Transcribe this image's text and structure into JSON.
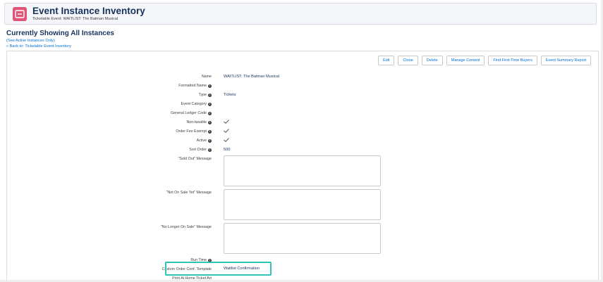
{
  "header": {
    "title": "Event Instance Inventory",
    "subtitle": "Ticketable Event: WAITLIST: The Batman Musical",
    "icon": "ticket-icon",
    "icon_color": "#e05576"
  },
  "page": {
    "showing_title": "Currently Showing All Instances",
    "see_active_link": "(See Active Instances Only)",
    "back_link": "« Back to: Ticketable Event Inventory"
  },
  "toolbar": {
    "buttons": [
      {
        "label": "Edit"
      },
      {
        "label": "Clone"
      },
      {
        "label": "Delete"
      },
      {
        "label": "Manage Content"
      },
      {
        "label": "Find First-Time Buyers"
      },
      {
        "label": "Event Summary Report"
      }
    ]
  },
  "fields": {
    "name": {
      "label": "Name",
      "value": "WAITLIST: The Batman Musical"
    },
    "formatted_name": {
      "label": "Formatted Name",
      "value": ""
    },
    "type": {
      "label": "Type",
      "value": "Tickets"
    },
    "event_category": {
      "label": "Event Category",
      "value": ""
    },
    "gl_code": {
      "label": "General Ledger Code",
      "value": ""
    },
    "non_taxable": {
      "label": "Non-taxable",
      "checked": true
    },
    "order_fee_exempt": {
      "label": "Order Fee Exempt",
      "checked": true
    },
    "active": {
      "label": "Active",
      "checked": true
    },
    "sort_order": {
      "label": "Sort Order",
      "value": "500"
    },
    "sold_out_message": {
      "label": "\"Sold Out\" Message",
      "value": ""
    },
    "not_on_sale_message": {
      "label": "\"Not On Sale Yet\" Message",
      "value": ""
    },
    "no_longer_on_sale_message": {
      "label": "\"No Longer On Sale\" Message",
      "value": ""
    },
    "run_time": {
      "label": "Run Time",
      "value": ""
    },
    "custom_order_conf_template": {
      "label": "Custom Order Conf. Template",
      "value": "Waitlist Confirmation"
    },
    "print_at_home": {
      "label": "Print At Home Ticket Art",
      "value": ""
    }
  },
  "colors": {
    "link": "#0070d2",
    "title": "#16325c",
    "highlight": "#2ec4b6"
  }
}
